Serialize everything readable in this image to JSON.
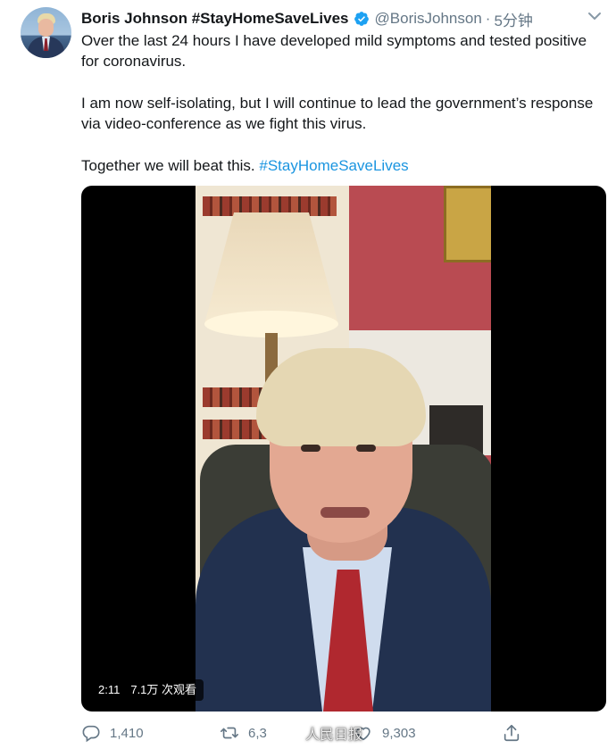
{
  "tweet": {
    "author_name": "Boris Johnson #StayHomeSaveLives",
    "handle": "@BorisJohnson",
    "separator": "·",
    "time": "5分钟",
    "paragraph1": "Over the last 24 hours I have developed mild symptoms and tested positive for coronavirus.",
    "paragraph2": "I am now self-isolating, but I will continue to lead the government’s response via video-conference as we fight this virus.",
    "paragraph3_prefix": "Together we will beat this.",
    "paragraph3_hashtag": "#StayHomeSaveLives"
  },
  "video": {
    "duration": "2:11",
    "views": "7.1万 次观看"
  },
  "actions": {
    "reply_count": "1,410",
    "retweet_count": "6,3",
    "like_count": "9,303"
  },
  "watermark": {
    "text": "人民日报",
    "icon": "weibo-icon"
  },
  "colors": {
    "link": "#1b95e0",
    "muted": "#657786",
    "verified": "#1da1f2"
  },
  "icons": {
    "verified": "verified-badge-icon",
    "caret": "chevron-down-icon",
    "reply": "reply-icon",
    "retweet": "retweet-icon",
    "like": "heart-icon",
    "share": "share-icon"
  }
}
